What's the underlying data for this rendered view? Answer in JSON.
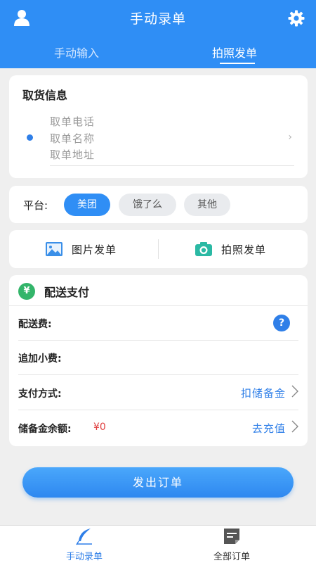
{
  "header": {
    "title": "手动录单",
    "user_icon": "user-icon",
    "settings_icon": "gear-icon"
  },
  "tabs": [
    {
      "label": "手动输入",
      "active": false
    },
    {
      "label": "拍照发单",
      "active": true
    }
  ],
  "pickup": {
    "title": "取货信息",
    "phone_placeholder": "取单电话",
    "name_placeholder": "取单名称",
    "address_placeholder": "取单地址",
    "chevron": "›"
  },
  "platform": {
    "label": "平台:",
    "options": [
      {
        "label": "美团",
        "selected": true
      },
      {
        "label": "饿了么",
        "selected": false
      },
      {
        "label": "其他",
        "selected": false
      }
    ]
  },
  "send": {
    "image_label": "图片发单",
    "camera_label": "拍照发单"
  },
  "payment": {
    "icon_text": "¥",
    "title": "配送支付",
    "rows": [
      {
        "key": "配送费:"
      },
      {
        "key": "追加小费:"
      },
      {
        "key": "支付方式:",
        "link": "扣储备金"
      },
      {
        "key": "储备金余额:",
        "value": "¥0",
        "link": "去充值"
      }
    ],
    "help_icon_text": "?"
  },
  "submit_label": "发出订单",
  "bottom_nav": [
    {
      "label": "手动录单",
      "icon": "feather-icon",
      "active": true
    },
    {
      "label": "全部订单",
      "icon": "orders-icon",
      "active": false
    }
  ],
  "colors": {
    "accent": "#2f8ef5",
    "money": "#e04040",
    "yen_badge": "#33b56a"
  }
}
